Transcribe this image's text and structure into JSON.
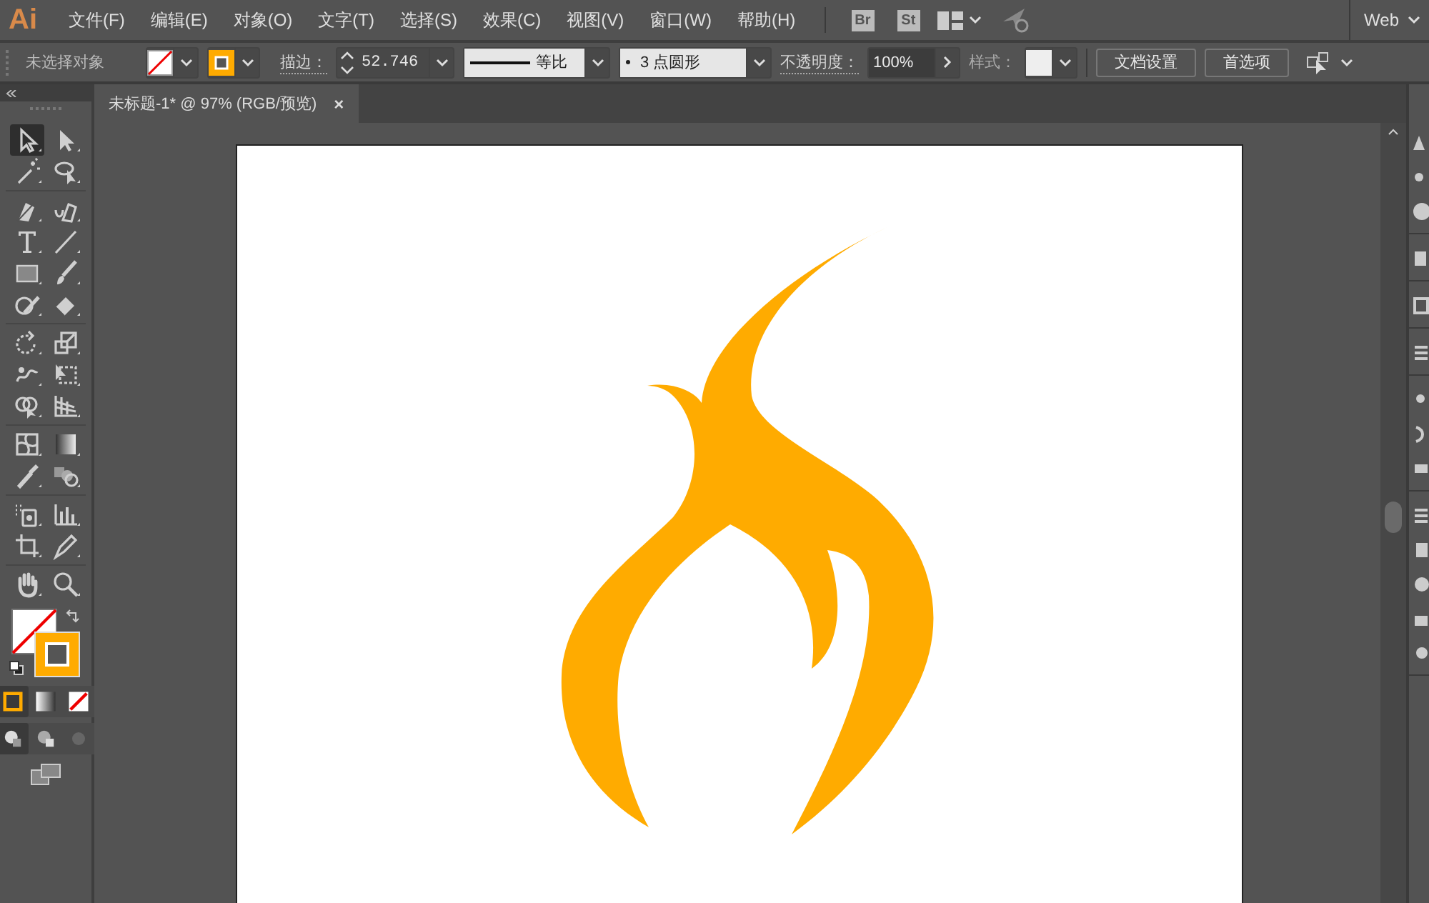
{
  "app_bar": {
    "logo": "Ai",
    "menus": [
      "文件(F)",
      "编辑(E)",
      "对象(O)",
      "文字(T)",
      "选择(S)",
      "效果(C)",
      "视图(V)",
      "窗口(W)",
      "帮助(H)"
    ],
    "bridge": "Br",
    "stock": "St",
    "workspace": "Web"
  },
  "control_bar": {
    "selection": "未选择对象",
    "stroke_label": "描边：",
    "stroke_weight": "52.746",
    "profile": "等比",
    "brush": "3 点圆形",
    "opacity_label": "不透明度：",
    "opacity": "100%",
    "style_label": "样式：",
    "buttons": [
      "文档设置",
      "首选项"
    ]
  },
  "document_tab": {
    "title": "未标题-1* @ 97% (RGB/预览)",
    "close": "×"
  },
  "tools": [
    {
      "selected": true
    },
    {
      "selected": false
    },
    {
      "selected": false
    },
    {
      "selected": false
    },
    {
      "selected": false
    },
    {
      "selected": false
    },
    {
      "selected": false
    },
    {
      "selected": false
    },
    {
      "selected": false
    },
    {
      "selected": false
    },
    {
      "selected": false
    },
    {
      "selected": false
    },
    {
      "selected": false
    },
    {
      "selected": false
    },
    {
      "selected": false
    },
    {
      "selected": false
    },
    {
      "selected": false
    },
    {
      "selected": false
    },
    {
      "selected": false
    },
    {
      "selected": false
    },
    {
      "selected": false
    },
    {
      "selected": false
    },
    {
      "selected": false
    },
    {
      "selected": false
    },
    {
      "selected": false
    },
    {
      "selected": false
    }
  ],
  "color_modes": [
    {
      "selected": true
    },
    {
      "selected": false
    },
    {
      "selected": false
    }
  ],
  "draw_modes": [
    {
      "selected": true
    },
    {
      "selected": false
    },
    {
      "selected": false
    }
  ]
}
